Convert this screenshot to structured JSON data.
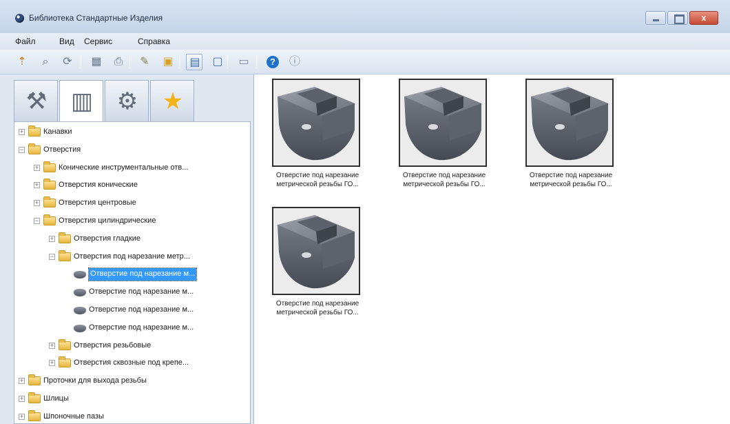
{
  "window": {
    "title": "Библиотека Стандартные Изделия",
    "close_label": "x"
  },
  "menu": [
    "Файл",
    "Вид",
    "Сервис",
    "Справка"
  ],
  "toolbar": {
    "buttons": [
      {
        "icon": "insert-part-icon",
        "glyph": "⇡",
        "color": "#c77d1a"
      },
      {
        "icon": "find-icon",
        "glyph": "⌕",
        "color": "#5a6b85"
      },
      {
        "icon": "refresh-icon",
        "glyph": "⟳",
        "color": "#6a7a90"
      },
      {
        "icon": "table-icon",
        "glyph": "▦",
        "color": "#6a7a90"
      },
      {
        "icon": "print-icon",
        "glyph": "⎙",
        "color": "#6a7a90"
      },
      {
        "icon": "edit-icon",
        "glyph": "✎",
        "color": "#8a8a5a"
      },
      {
        "icon": "open-icon",
        "glyph": "▣",
        "color": "#d5a126"
      },
      {
        "icon": "view-list-icon",
        "glyph": "▤",
        "color": "#3c6cb4"
      },
      {
        "icon": "view-tiles-icon",
        "glyph": "▢",
        "color": "#3c6cb4"
      },
      {
        "icon": "properties-icon",
        "glyph": "▭",
        "color": "#7d8aa0"
      },
      {
        "icon": "help-icon",
        "glyph": "?",
        "color": "#ffffff"
      },
      {
        "icon": "about-icon",
        "glyph": "ⓘ",
        "color": "#7d8aa0"
      }
    ]
  },
  "tabs": [
    {
      "icon": "tool-icon",
      "glyph": "⚒"
    },
    {
      "icon": "library-icon",
      "glyph": "▥"
    },
    {
      "icon": "fastener-icon",
      "glyph": "⚙"
    },
    {
      "icon": "favorites-star-icon",
      "glyph": "★"
    }
  ],
  "tree": [
    {
      "label": "Канавки",
      "level": 0,
      "expander": "+",
      "type": "folder"
    },
    {
      "label": "Отверстия",
      "level": 0,
      "expander": "−",
      "type": "folder"
    },
    {
      "label": "Конические инструментальные отв...",
      "level": 1,
      "expander": "+",
      "type": "folder"
    },
    {
      "label": "Отверстия конические",
      "level": 1,
      "expander": "+",
      "type": "folder"
    },
    {
      "label": "Отверстия центровые",
      "level": 1,
      "expander": "+",
      "type": "folder"
    },
    {
      "label": "Отверстия цилиндрические",
      "level": 1,
      "expander": "−",
      "type": "folder"
    },
    {
      "label": "Отверстия гладкие",
      "level": 2,
      "expander": "+",
      "type": "folder"
    },
    {
      "label": "Отверстия под нарезание метр...",
      "level": 2,
      "expander": "−",
      "type": "folder"
    },
    {
      "label": "Отверстие под нарезание м...",
      "level": 3,
      "expander": "",
      "type": "part",
      "selected": true
    },
    {
      "label": "Отверстие под нарезание м...",
      "level": 3,
      "expander": "",
      "type": "part"
    },
    {
      "label": "Отверстие под нарезание м...",
      "level": 3,
      "expander": "",
      "type": "part"
    },
    {
      "label": "Отверстие под нарезание м...",
      "level": 3,
      "expander": "",
      "type": "part"
    },
    {
      "label": "Отверстия резьбовые",
      "level": 2,
      "expander": "+",
      "type": "folder"
    },
    {
      "label": "Отверстия сквозные под крепе...",
      "level": 2,
      "expander": "+",
      "type": "folder"
    },
    {
      "label": "Проточки для выхода резьбы",
      "level": 0,
      "expander": "+",
      "type": "folder"
    },
    {
      "label": "Шлицы",
      "level": 0,
      "expander": "+",
      "type": "folder"
    },
    {
      "label": "Шпоночные пазы",
      "level": 0,
      "expander": "+",
      "type": "folder"
    }
  ],
  "items": [
    {
      "caption": "Отверстие под нарезание метрической резьбы ГО..."
    },
    {
      "caption": "Отверстие под нарезание метрической резьбы ГО..."
    },
    {
      "caption": "Отверстие под нарезание метрической резьбы ГО..."
    },
    {
      "caption": "Отверстие под нарезание метрической резьбы ГО..."
    }
  ],
  "colors": {
    "selection": "#3399ff",
    "folder": "#e7b53c",
    "part": "#4e5460"
  }
}
